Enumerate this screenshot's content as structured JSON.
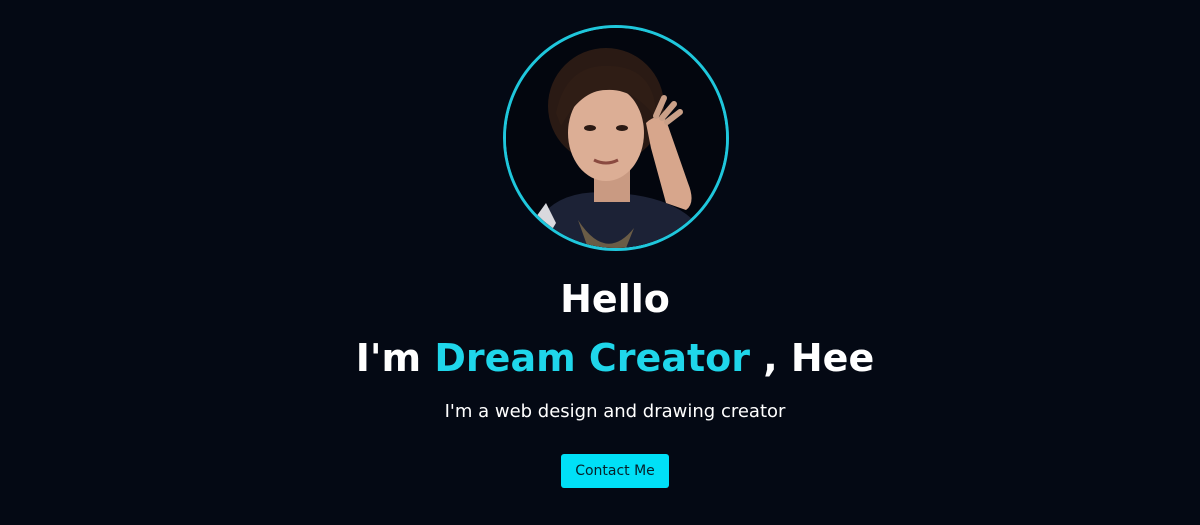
{
  "hero": {
    "avatar_alt": "profile photo",
    "greeting": "Hello",
    "intro_prefix": "I'm ",
    "intro_highlight": "Dream Creator",
    "intro_suffix": " , Hee",
    "tagline": "I'm a web design and drawing creator",
    "contact_label": "Contact Me"
  },
  "colors": {
    "background": "#040914",
    "accent": "#1fd6ea",
    "button": "#00e0f7",
    "text": "#ffffff"
  }
}
